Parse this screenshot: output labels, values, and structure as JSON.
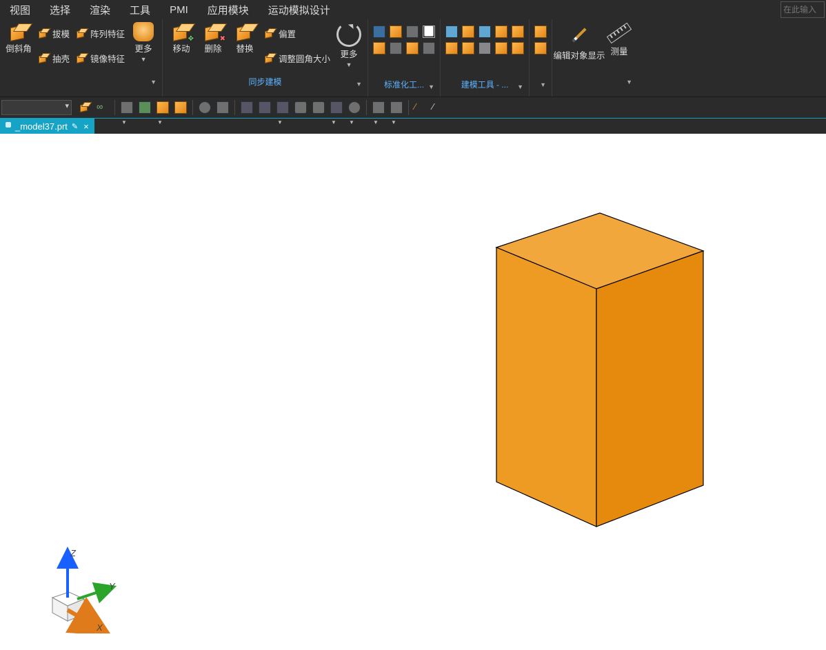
{
  "menus": {
    "view": "视图",
    "select": "选择",
    "render": "渲染",
    "tools": "工具",
    "pmi": "PMI",
    "app_modules": "应用模块",
    "motion_sim_design": "运动模拟设计"
  },
  "command_placeholder": "在此输入",
  "ribbon": {
    "g_feature": {
      "top_chamfer": "倒斜角",
      "draft": "拔模",
      "pattern_feature": "阵列特征",
      "shell": "抽壳",
      "mirror_feature": "镜像特征",
      "more": "更多",
      "caption": " "
    },
    "g_sync": {
      "move": "移动",
      "delete": "删除",
      "replace": "替换",
      "offset": "偏置",
      "adjust_fillet": "调整圆角大小",
      "more": "更多",
      "caption": "同步建模"
    },
    "g_std": {
      "caption": "标准化工..."
    },
    "g_model": {
      "caption": "建模工具 - ..."
    },
    "g_vis": {
      "edit_display": "编辑对象显示",
      "measure": "测量"
    }
  },
  "doc_tab": {
    "filename": "_model37.prt",
    "modified_mark": "✎",
    "close": "×"
  },
  "triad": {
    "x": "X",
    "y": "Y",
    "z": "Z"
  }
}
